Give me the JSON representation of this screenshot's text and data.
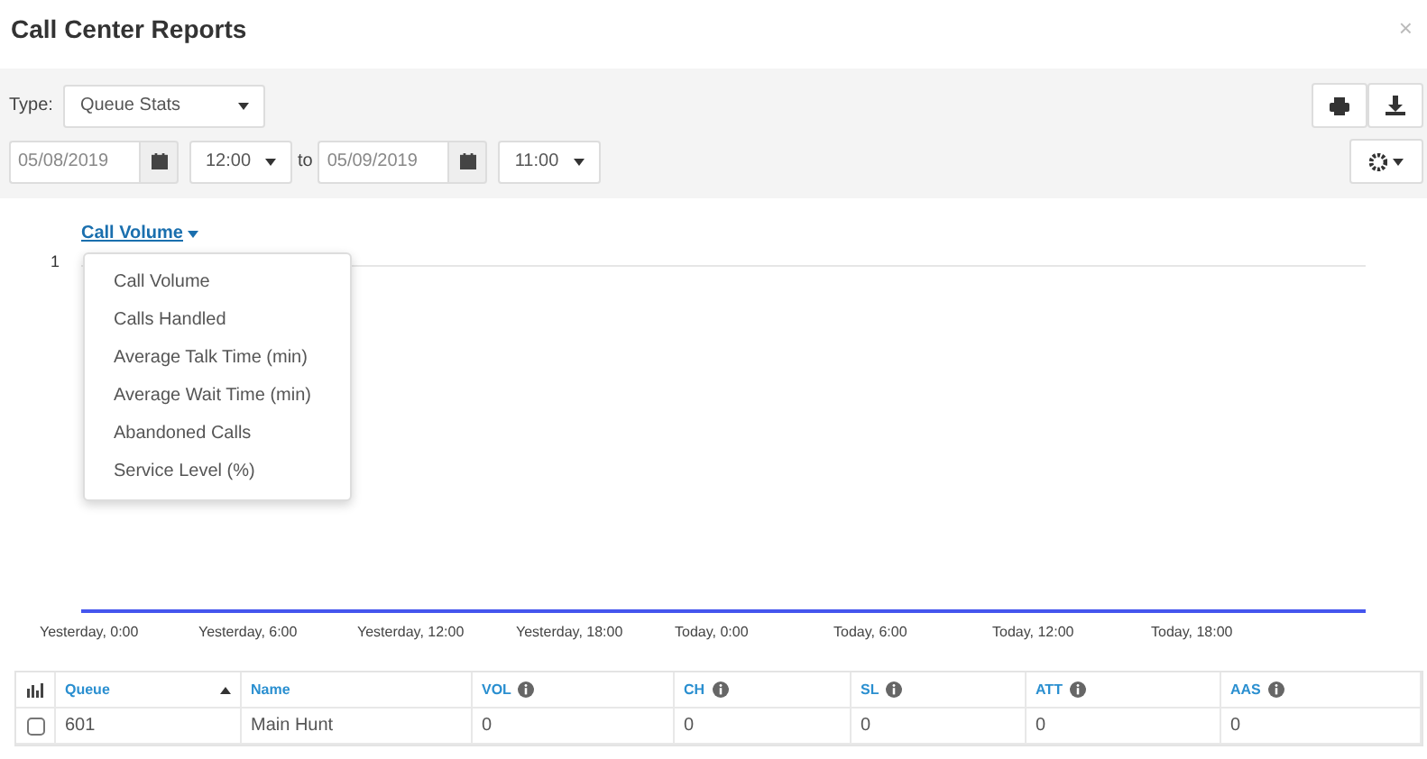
{
  "window": {
    "title": "Call Center Reports",
    "close": "×"
  },
  "filters": {
    "type_label": "Type:",
    "type_value": "Queue Stats",
    "start_date": "05/08/2019",
    "start_time": "12:00",
    "to_label": "to",
    "end_date": "05/09/2019",
    "end_time": "11:00"
  },
  "chart": {
    "metric": "Call Volume",
    "menu_open": true,
    "menu": [
      "Call Volume",
      "Calls Handled",
      "Average Talk Time (min)",
      "Average Wait Time (min)",
      "Abandoned Calls",
      "Service Level (%)"
    ],
    "y_tick": "1",
    "x_labels": [
      "Yesterday, 0:00",
      "Yesterday, 6:00",
      "Yesterday, 12:00",
      "Yesterday, 18:00",
      "Today, 0:00",
      "Today, 6:00",
      "Today, 12:00",
      "Today, 18:00"
    ]
  },
  "table": {
    "columns": [
      {
        "label": "Queue",
        "sorted": true,
        "info": false
      },
      {
        "label": "Name",
        "sorted": false,
        "info": false
      },
      {
        "label": "VOL",
        "sorted": false,
        "info": true
      },
      {
        "label": "CH",
        "sorted": false,
        "info": true
      },
      {
        "label": "SL",
        "sorted": false,
        "info": true
      },
      {
        "label": "ATT",
        "sorted": false,
        "info": true
      },
      {
        "label": "AAS",
        "sorted": false,
        "info": true
      }
    ],
    "rows": [
      {
        "checked": false,
        "cells": [
          "601",
          "Main Hunt",
          "0",
          "0",
          "0",
          "0",
          "0"
        ]
      }
    ]
  }
}
